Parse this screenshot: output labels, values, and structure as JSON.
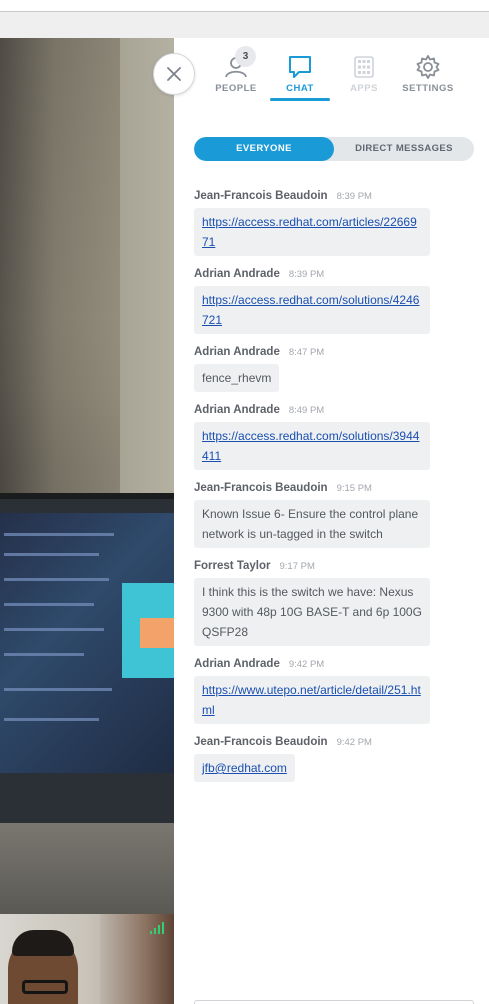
{
  "tabs": [
    {
      "label": "PEOPLE",
      "icon": "people-icon",
      "badge": "3",
      "state": "normal"
    },
    {
      "label": "CHAT",
      "icon": "chat-icon",
      "state": "active"
    },
    {
      "label": "APPS",
      "icon": "apps-grid-icon",
      "state": "disabled"
    },
    {
      "label": "SETTINGS",
      "icon": "gear-icon",
      "state": "normal"
    }
  ],
  "filter": {
    "everyone": "EVERYONE",
    "direct": "DIRECT MESSAGES"
  },
  "messages": [
    {
      "author": "Jean-Francois Beaudoin",
      "time": "8:39 PM",
      "text": "https://access.redhat.com/articles/2266971",
      "is_link": true
    },
    {
      "author": "Adrian Andrade",
      "time": "8:39 PM",
      "text": "https://access.redhat.com/solutions/4246721",
      "is_link": true
    },
    {
      "author": "Adrian Andrade",
      "time": "8:47 PM",
      "text": "fence_rhevm",
      "is_link": false
    },
    {
      "author": "Adrian Andrade",
      "time": "8:49 PM",
      "text": "https://access.redhat.com/solutions/3944411",
      "is_link": true
    },
    {
      "author": "Jean-Francois Beaudoin",
      "time": "9:15 PM",
      "text": "Known Issue 6- Ensure the control plane network is un-tagged in the switch",
      "is_link": false
    },
    {
      "author": "Forrest Taylor",
      "time": "9:17 PM",
      "text": "I think this is the switch we have: Nexus 9300 with 48p 10G BASE-T and 6p 100G QSFP28",
      "is_link": false
    },
    {
      "author": "Adrian Andrade",
      "time": "9:42 PM",
      "text": "https://www.utepo.net/article/detail/251.html",
      "is_link": true
    },
    {
      "author": "Jean-Francois Beaudoin",
      "time": "9:42 PM",
      "text": "jfb@redhat.com",
      "is_link": true
    }
  ],
  "colors": {
    "accent": "#1a9bd7",
    "signal": "#2fcf72"
  }
}
